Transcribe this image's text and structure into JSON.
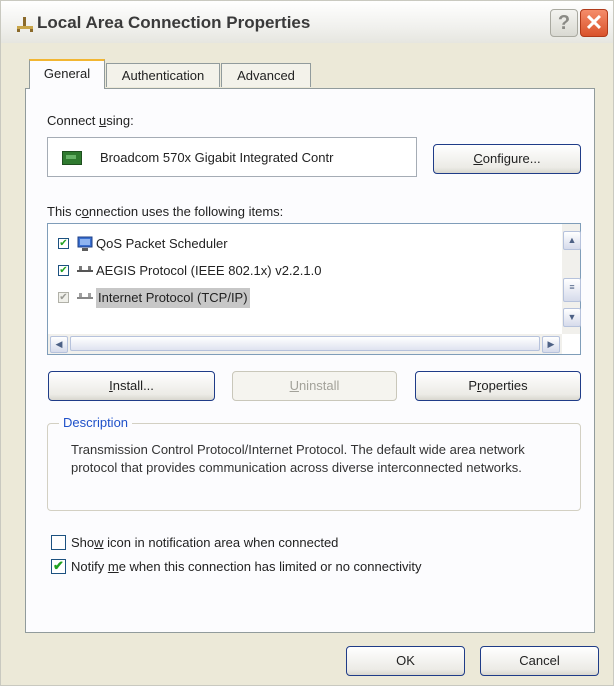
{
  "window": {
    "title": "Local Area Connection Properties",
    "help": "?",
    "close": "✕"
  },
  "tabs": [
    {
      "label": "General"
    },
    {
      "label": "Authentication"
    },
    {
      "label": "Advanced"
    }
  ],
  "connect_using": {
    "label_pre": "Connect ",
    "label_ul": "u",
    "label_post": "sing:",
    "adapter": "Broadcom 570x Gigabit Integrated Contr",
    "configure_pre": "",
    "configure_ul": "C",
    "configure_post": "onfigure..."
  },
  "items_section": {
    "label_pre": "This c",
    "label_ul": "o",
    "label_post": "nnection uses the following items:",
    "items": [
      {
        "label": "QoS Packet Scheduler",
        "checked": true,
        "icon": "qos-icon"
      },
      {
        "label": "AEGIS Protocol (IEEE 802.1x) v2.2.1.0",
        "checked": true,
        "icon": "protocol-icon"
      },
      {
        "label": "Internet Protocol (TCP/IP)",
        "checked": true,
        "selected": true,
        "icon": "protocol-icon"
      }
    ]
  },
  "buttons": {
    "install_ul": "I",
    "install_post": "nstall...",
    "uninstall_ul": "U",
    "uninstall_post": "ninstall",
    "properties_pre": "P",
    "properties_ul": "r",
    "properties_post": "operties"
  },
  "description": {
    "title": "Description",
    "text": "Transmission Control Protocol/Internet Protocol. The default wide area network protocol that provides communication across diverse interconnected networks."
  },
  "options": {
    "show_icon_pre": "Sho",
    "show_icon_ul": "w",
    "show_icon_post": " icon in notification area when connected",
    "show_icon_checked": false,
    "notify_pre": "Notify ",
    "notify_ul": "m",
    "notify_post": "e when this connection has limited or no connectivity",
    "notify_checked": true
  },
  "footer": {
    "ok": "OK",
    "cancel": "Cancel"
  },
  "colors": {
    "close_button": "#d9532b",
    "description_title": "#1f51c9",
    "active_tab_accent": "#f2b632"
  }
}
